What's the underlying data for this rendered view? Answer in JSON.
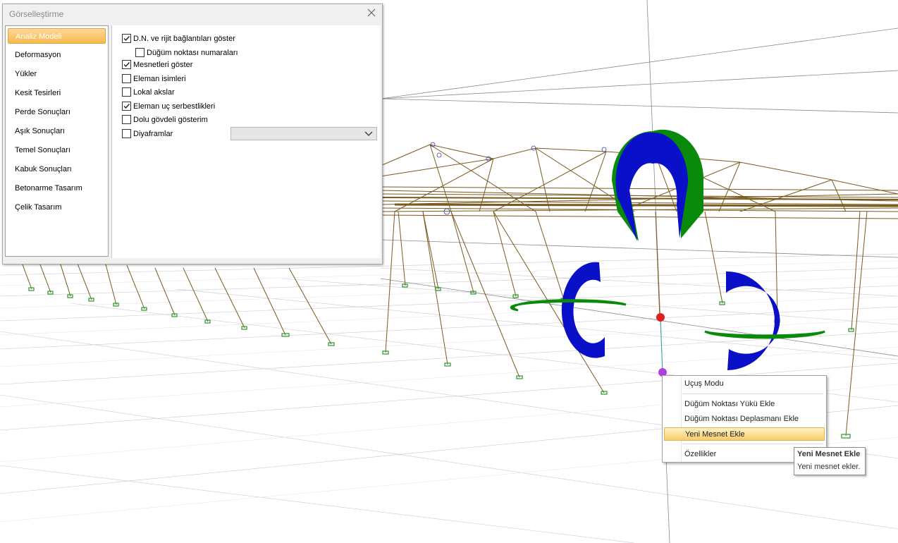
{
  "dialog": {
    "title": "Görselleştirme",
    "close_icon": "close-icon",
    "nav": [
      {
        "label": "Analiz Modeli",
        "active": true
      },
      {
        "label": "Deformasyon",
        "active": false
      },
      {
        "label": "Yükler",
        "active": false
      },
      {
        "label": "Kesit Tesirleri",
        "active": false
      },
      {
        "label": "Perde Sonuçları",
        "active": false
      },
      {
        "label": "Aşık Sonuçları",
        "active": false
      },
      {
        "label": "Temel Sonuçları",
        "active": false
      },
      {
        "label": "Kabuk Sonuçları",
        "active": false
      },
      {
        "label": "Betonarme Tasarım",
        "active": false
      },
      {
        "label": "Çelik Tasarım",
        "active": false
      }
    ],
    "options": [
      {
        "label": "D.N. ve rijit bağlantıları göster",
        "checked": true
      },
      {
        "label": "Düğüm noktası numaraları",
        "checked": false
      },
      {
        "label": "Mesnetleri göster",
        "checked": true
      },
      {
        "label": "Eleman isimleri",
        "checked": false
      },
      {
        "label": "Lokal akslar",
        "checked": false
      },
      {
        "label": "Eleman uç serbestlikleri",
        "checked": true
      },
      {
        "label": "Dolu gövdeli gösterim",
        "checked": false
      },
      {
        "label": "Diyaframlar",
        "checked": false
      }
    ],
    "diyafram_select_value": ""
  },
  "context_menu": {
    "items": [
      {
        "label": "Uçuş Modu",
        "active": false
      },
      {
        "label": "Düğüm Noktası Yükü Ekle",
        "active": false
      },
      {
        "label": "Düğüm Noktası Deplasmanı Ekle",
        "active": false
      },
      {
        "label": "Yeni Mesnet Ekle",
        "active": true
      },
      {
        "label": "Özellikler",
        "active": false
      }
    ]
  },
  "tooltip": {
    "title": "Yeni Mesnet Ekle",
    "description": "Yeni mesnet ekler."
  },
  "colors": {
    "truss": "#7a5a1e",
    "blue_arrow": "#0a10c8",
    "green_arrow": "#0a8a0a",
    "selected_node": "#e02020",
    "hover_node": "#b040e0",
    "support_marker": "#2a9a2a",
    "menu_highlight": "#f8cd6a",
    "nav_active": "#f7b94c"
  }
}
